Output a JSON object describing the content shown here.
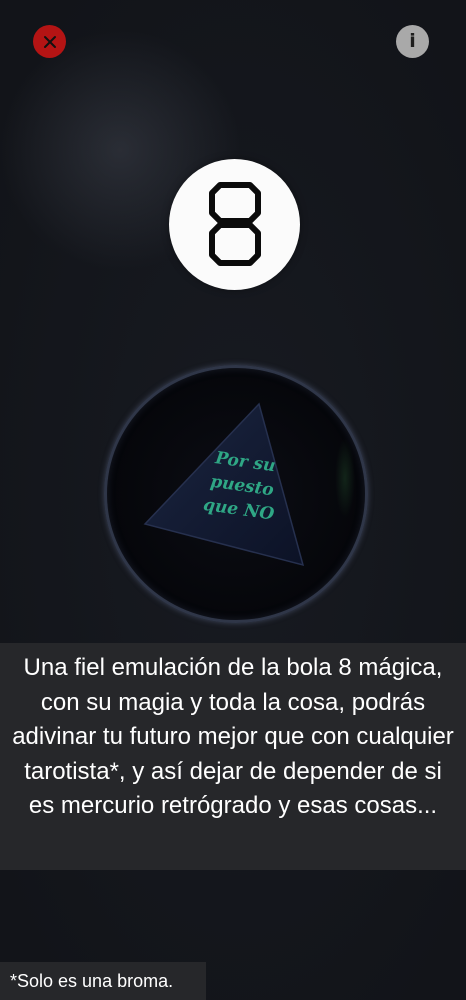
{
  "header": {
    "close_icon": "close-icon",
    "info_label": "i"
  },
  "logo": {
    "number": "8"
  },
  "ball": {
    "answer_lines": [
      "Por su",
      "puesto",
      "que NO"
    ],
    "answer_color": "#2fa785"
  },
  "description": {
    "text": "Una fiel emulación de la bola 8 mágica, con su magia y toda la cosa, podrás adivinar tu futuro mejor que con cualquier tarotista*, y así dejar de depender de si es mercurio retrógrado y esas cosas..."
  },
  "footnote": {
    "text": "*Solo es una broma."
  },
  "colors": {
    "background": "#121419",
    "close_button": "#b41414",
    "info_button": "#a9a9a9",
    "panel": "#26272a"
  }
}
